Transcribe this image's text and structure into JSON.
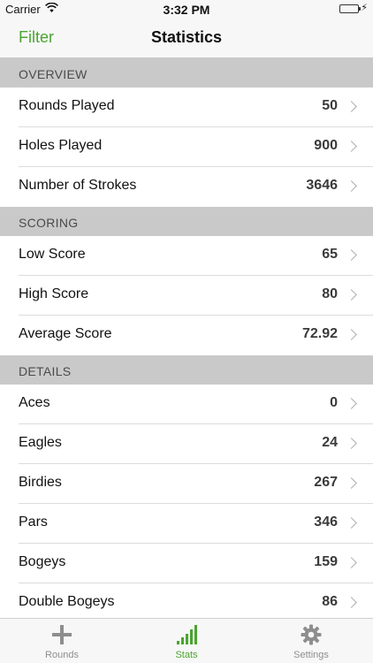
{
  "status_bar": {
    "carrier": "Carrier",
    "time": "3:32 PM"
  },
  "nav": {
    "filter_label": "Filter",
    "title": "Statistics"
  },
  "sections": [
    {
      "header": "OVERVIEW",
      "rows": [
        {
          "label": "Rounds Played",
          "value": "50"
        },
        {
          "label": "Holes Played",
          "value": "900"
        },
        {
          "label": "Number of Strokes",
          "value": "3646"
        }
      ]
    },
    {
      "header": "SCORING",
      "rows": [
        {
          "label": "Low Score",
          "value": "65"
        },
        {
          "label": "High Score",
          "value": "80"
        },
        {
          "label": "Average Score",
          "value": "72.92"
        }
      ]
    },
    {
      "header": "DETAILS",
      "rows": [
        {
          "label": "Aces",
          "value": "0"
        },
        {
          "label": "Eagles",
          "value": "24"
        },
        {
          "label": "Birdies",
          "value": "267"
        },
        {
          "label": "Pars",
          "value": "346"
        },
        {
          "label": "Bogeys",
          "value": "159"
        },
        {
          "label": "Double Bogeys",
          "value": "86"
        }
      ]
    }
  ],
  "tabbar": [
    {
      "label": "Rounds",
      "icon": "plus-icon"
    },
    {
      "label": "Stats",
      "icon": "bar-chart-icon"
    },
    {
      "label": "Settings",
      "icon": "gear-icon"
    }
  ],
  "colors": {
    "accent": "#4aa52f",
    "section_bg": "#c9c9c9"
  }
}
